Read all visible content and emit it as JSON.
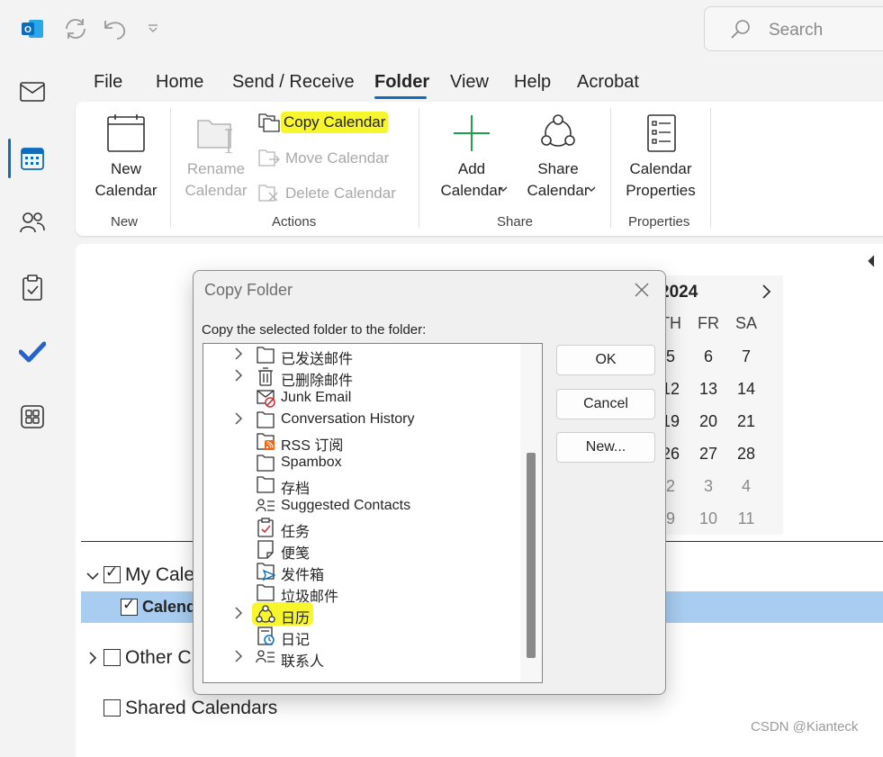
{
  "search": {
    "placeholder": "Search"
  },
  "tabs": [
    "File",
    "Home",
    "Send / Receive",
    "Folder",
    "View",
    "Help",
    "Acrobat"
  ],
  "active_tab": "Folder",
  "ribbon": {
    "new_calendar": "New\nCalendar",
    "rename_calendar": "Rename\nCalendar",
    "copy_calendar": "Copy Calendar",
    "move_calendar": "Move Calendar",
    "delete_calendar": "Delete Calendar",
    "add_calendar": "Add\nCalendar",
    "share_calendar": "Share\nCalendar",
    "calendar_properties": "Calendar\nProperties",
    "groups": {
      "new": "New",
      "actions": "Actions",
      "share": "Share",
      "properties": "Properties"
    }
  },
  "mini_calendar": {
    "year_fragment": "2024",
    "headers": [
      "TH",
      "FR",
      "SA"
    ],
    "rows": [
      [
        "5",
        "6",
        "7"
      ],
      [
        "12",
        "13",
        "14"
      ],
      [
        "19",
        "20",
        "21"
      ],
      [
        "26",
        "27",
        "28"
      ],
      [
        "2",
        "3",
        "4"
      ],
      [
        "9",
        "10",
        "11"
      ]
    ]
  },
  "calendar_list": {
    "my_calendars": "My Cale",
    "calendar_item": "Calend",
    "other_calendars": "Other C",
    "shared_calendars": "Shared Calendars"
  },
  "dialog": {
    "title": "Copy Folder",
    "prompt": "Copy the selected folder to the folder:",
    "ok": "OK",
    "cancel": "Cancel",
    "new": "New...",
    "folders": [
      {
        "label": "已发送邮件",
        "icon": "folder-icon",
        "expandable": true
      },
      {
        "label": "已删除邮件",
        "icon": "trash-icon",
        "expandable": true
      },
      {
        "label": "Junk Email",
        "icon": "junk-mail-icon",
        "expandable": false
      },
      {
        "label": "Conversation History",
        "icon": "folder-icon",
        "expandable": true
      },
      {
        "label": "RSS 订阅",
        "icon": "rss-folder-icon",
        "expandable": false
      },
      {
        "label": "Spambox",
        "icon": "folder-icon",
        "expandable": false
      },
      {
        "label": "存档",
        "icon": "folder-icon",
        "expandable": false
      },
      {
        "label": "Suggested Contacts",
        "icon": "contacts-icon",
        "expandable": false
      },
      {
        "label": "任务",
        "icon": "tasks-icon",
        "expandable": false
      },
      {
        "label": "便笺",
        "icon": "note-icon",
        "expandable": false
      },
      {
        "label": "发件箱",
        "icon": "outbox-icon",
        "expandable": false
      },
      {
        "label": "垃圾邮件",
        "icon": "folder-icon",
        "expandable": false
      },
      {
        "label": "日历",
        "icon": "shared-calendar-icon",
        "expandable": true,
        "highlighted": true
      },
      {
        "label": "日记",
        "icon": "journal-icon",
        "expandable": false
      },
      {
        "label": "联系人",
        "icon": "contacts-icon",
        "expandable": true
      }
    ]
  },
  "watermark": "CSDN @Kianteck",
  "colors": {
    "accent": "#0f6cbd",
    "highlight": "#f7f52b",
    "selected_row": "#a8cdf0"
  }
}
